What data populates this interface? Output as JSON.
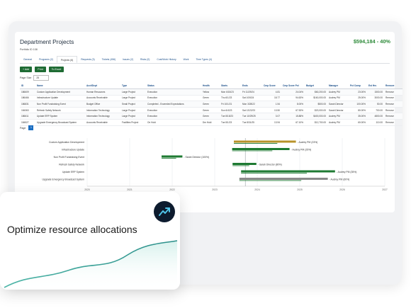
{
  "header": {
    "title": "Department Projects",
    "amount": "$594,184 - 40%"
  },
  "portfolio_line": "Portfolio ID   108",
  "tabs": [
    "General",
    "Programs (2)",
    "Projects (6)",
    "Requests (3)",
    "Tickets (456)",
    "Issues (2)",
    "Risks (0)",
    "Cost/Work History",
    "Work",
    "Time Types (4)"
  ],
  "active_tab": 2,
  "buttons": {
    "add": "+ Add",
    "print": "Print",
    "excel": "To Excel"
  },
  "page_size": {
    "label": "Page Size",
    "value": "25"
  },
  "table": {
    "columns": [
      "ID",
      "Name",
      "Acct/Dept",
      "Type",
      "Status",
      "Health",
      "Starts",
      "Ends",
      "Cmp Score",
      "Cmp Score Pct",
      "Budget",
      "Manager",
      "Pct Comp",
      "Est Hrs",
      "Remove"
    ],
    "rows": [
      [
        "186609",
        "Custom Application Development",
        "Human Resources",
        "Large Project",
        "Execution",
        "Yellow",
        "Mon 6/15/23",
        "Fri 11/29/24",
        "4.81",
        "24.04%",
        "$60,200.00",
        "Audrey PM",
        "23.00%",
        "1500.00",
        "Remove"
      ],
      [
        "186466",
        "Infrastructure Update",
        "Accounts Receivable",
        "Large Project",
        "Execution",
        "Green",
        "Thu 6/1/23",
        "Sat 10/5/24",
        "18.77",
        "94.63%",
        "$160,000.00",
        "Audrey PM",
        "25.00%",
        "3000.00",
        "Remove"
      ],
      [
        "186831",
        "Non Profit Fundraising Event",
        "Budget Office",
        "Small Project",
        "Completed - Exceeded Expectations",
        "Green",
        "Fri 10/1/21",
        "Mon 3/28/22",
        "1.54",
        "8.00%",
        "$500.00",
        "Sarah Director",
        "100.00%",
        "50.00",
        "Remove"
      ],
      [
        "184363",
        "Refresh Safety Network",
        "Information Technology",
        "Large Project",
        "Execution",
        "Green",
        "Sun 6/4/23",
        "Sat 12/22/23",
        "13.50",
        "67.53%",
        "$20,000.00",
        "Sarah Director",
        "80.00%",
        "700.00",
        "Remove"
      ],
      [
        "186611",
        "Update ERP System",
        "Information Technology",
        "Large Project",
        "Execution",
        "Green",
        "Tue 8/15/23",
        "Tue 10/29/25",
        "3.07",
        "15.88%",
        "$400,000.00",
        "Audrey PM",
        "35.00%",
        "4800.00",
        "Remove"
      ],
      [
        "184527",
        "Upgrade Emergency Broadcast System",
        "Accounts Receivable",
        "Facilities Project",
        "On Hold",
        "Dm Hold",
        "Tue 8/1/23",
        "Tue 8/31/25",
        "13.94",
        "67.10%",
        "$12,700.00",
        "Audrey PM",
        "60.00%",
        "110.00",
        "Remove"
      ]
    ]
  },
  "pager": {
    "label": "Page",
    "current": "1"
  },
  "chart_data": {
    "type": "gantt",
    "x_ticks": [
      "2020",
      "2021",
      "2022",
      "2023",
      "2024",
      "2025",
      "2026",
      "2027"
    ],
    "x_range": [
      2020.0,
      2027.0
    ],
    "tasks": [
      {
        "name": "Custom Application Development",
        "start": 2023.45,
        "end": 2024.91,
        "label": "Audrey PM (23%)",
        "color": "#b8932a"
      },
      {
        "name": "Infrastructure Update",
        "start": 2023.41,
        "end": 2024.76,
        "label": "Audrey PM (25%)",
        "color": "#1e7a32"
      },
      {
        "name": "Non Profit Fundraising Event",
        "start": 2021.75,
        "end": 2022.24,
        "label": "Sarah Director (100%)",
        "color": "#1e7a32"
      },
      {
        "name": "Refresh Safety Network",
        "start": 2023.42,
        "end": 2023.98,
        "label": "Sarah Director (80%)",
        "color": "#1e7a32"
      },
      {
        "name": "Update ERP System",
        "start": 2023.62,
        "end": 2025.83,
        "label": "Audrey PM (35%)",
        "color": "#1e7a32"
      },
      {
        "name": "Upgrade Emergency Broadcast System",
        "start": 2023.58,
        "end": 2025.66,
        "label": "Audrey PM (60%)",
        "color": "#8a8a8a"
      }
    ],
    "today": 2023.72
  },
  "card": {
    "text": "Optimize resource allocations"
  }
}
